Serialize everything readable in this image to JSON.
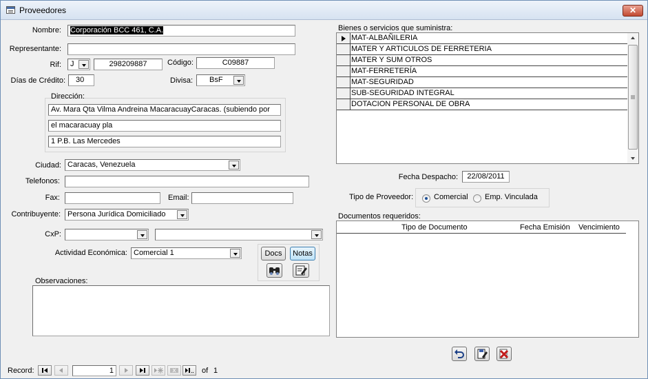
{
  "window": {
    "title": "Proveedores",
    "close_glyph": "✕"
  },
  "labels": {
    "nombre": "Nombre:",
    "representante": "Representante:",
    "rif": "Rif:",
    "codigo": "Código:",
    "dias_credito": "Días de Crédito:",
    "divisa": "Divisa:",
    "direccion": "Dirección:",
    "ciudad": "Ciudad:",
    "telefonos": "Telefonos:",
    "fax": "Fax:",
    "email": "Email:",
    "contribuyente": "Contribuyente:",
    "cxp": "CxP:",
    "actividad": "Actividad Económica:",
    "observaciones": "Observaciones:",
    "bienes": "Bienes o servicios que suministra:",
    "fecha_despacho": "Fecha Despacho:",
    "tipo_proveedor": "Tipo de Proveedor:",
    "documentos": "Documentos requeridos:"
  },
  "fields": {
    "nombre": "Corporación BCC 461, C.A.",
    "representante": "",
    "rif_tipo": "J",
    "rif_numero": "298209887",
    "codigo": "C09887",
    "dias_credito": "30",
    "divisa": "BsF",
    "direccion_1": "Av. Mara Qta Vilma Andreina MacaracuayCaracas. (subiendo por",
    "direccion_2": "el macaracuay pla",
    "direccion_3": "1 P.B. Las Mercedes",
    "ciudad": "Caracas, Venezuela",
    "telefonos": "",
    "fax": "",
    "email": "",
    "contribuyente": "Persona Jurídica Domiciliado",
    "cxp_1": "",
    "cxp_2": "",
    "actividad": "Comercial 1",
    "observaciones": "",
    "fecha_despacho": "22/08/2011"
  },
  "buttons": {
    "docs": "Docs",
    "notas": "Notas"
  },
  "bienes": [
    "MAT-ALBAÑILERIA",
    "MATER Y ARTICULOS DE FERRETERIA",
    "MATER Y SUM OTROS",
    "MAT-FERRETERÍA",
    "MAT-SEGURIDAD",
    "SUB-SEGURIDAD INTEGRAL",
    "DOTACION PERSONAL  DE OBRA"
  ],
  "tipo_proveedor": {
    "options": [
      "Comercial",
      "Emp. Vinculada"
    ],
    "selected": "Comercial"
  },
  "documentos": {
    "columns": [
      "Tipo de Documento",
      "Fecha Emisión",
      "Vencimiento"
    ]
  },
  "record_nav": {
    "label": "Record:",
    "current": "1",
    "of": "of",
    "total": "1"
  },
  "icons": {
    "binoculars": "binoculars-icon",
    "edit": "edit-note-icon",
    "undo": "undo-icon",
    "save": "save-icon",
    "delete": "delete-icon"
  }
}
